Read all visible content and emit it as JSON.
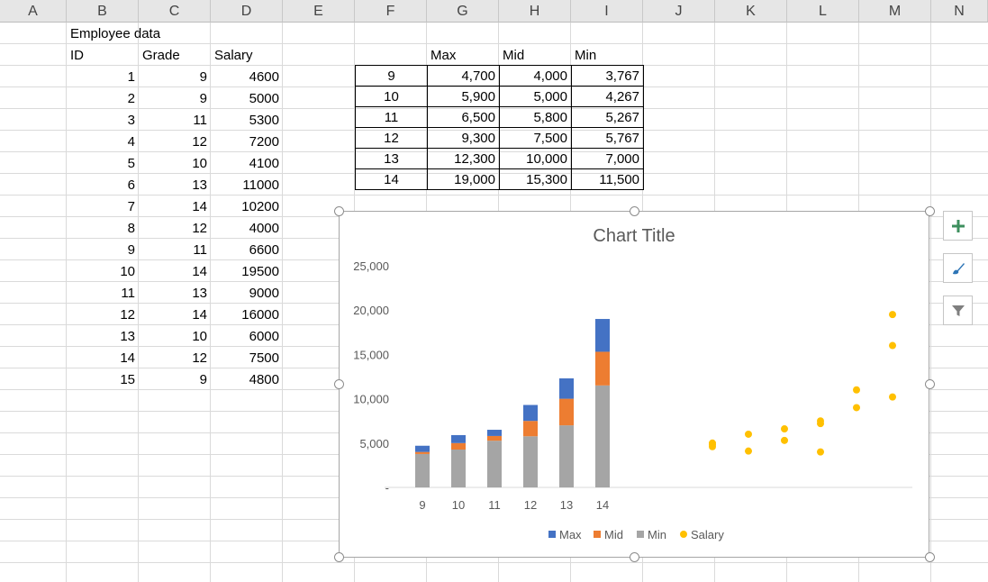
{
  "columns": [
    "A",
    "B",
    "C",
    "D",
    "E",
    "F",
    "G",
    "H",
    "I",
    "J",
    "K",
    "L",
    "M",
    "N"
  ],
  "sheet": {
    "title": "Employee data",
    "headers": {
      "id": "ID",
      "grade": "Grade",
      "salary": "Salary"
    },
    "rows": [
      {
        "id": "1",
        "grade": "9",
        "salary": "4600"
      },
      {
        "id": "2",
        "grade": "9",
        "salary": "5000"
      },
      {
        "id": "3",
        "grade": "11",
        "salary": "5300"
      },
      {
        "id": "4",
        "grade": "12",
        "salary": "7200"
      },
      {
        "id": "5",
        "grade": "10",
        "salary": "4100"
      },
      {
        "id": "6",
        "grade": "13",
        "salary": "11000"
      },
      {
        "id": "7",
        "grade": "14",
        "salary": "10200"
      },
      {
        "id": "8",
        "grade": "12",
        "salary": "4000"
      },
      {
        "id": "9",
        "grade": "11",
        "salary": "6600"
      },
      {
        "id": "10",
        "grade": "14",
        "salary": "19500"
      },
      {
        "id": "11",
        "grade": "13",
        "salary": "9000"
      },
      {
        "id": "12",
        "grade": "14",
        "salary": "16000"
      },
      {
        "id": "13",
        "grade": "10",
        "salary": "6000"
      },
      {
        "id": "14",
        "grade": "12",
        "salary": "7500"
      },
      {
        "id": "15",
        "grade": "9",
        "salary": "4800"
      }
    ]
  },
  "range_table": {
    "headers": {
      "max": "Max",
      "mid": "Mid",
      "min": "Min"
    },
    "rows": [
      {
        "grade": "9",
        "max": "4,700",
        "mid": "4,000",
        "min": "3,767"
      },
      {
        "grade": "10",
        "max": "5,900",
        "mid": "5,000",
        "min": "4,267"
      },
      {
        "grade": "11",
        "max": "6,500",
        "mid": "5,800",
        "min": "5,267"
      },
      {
        "grade": "12",
        "max": "9,300",
        "mid": "7,500",
        "min": "5,767"
      },
      {
        "grade": "13",
        "max": "12,300",
        "mid": "10,000",
        "min": "7,000"
      },
      {
        "grade": "14",
        "max": "19,000",
        "mid": "15,300",
        "min": "11,500"
      }
    ]
  },
  "chart_data": {
    "type": "bar",
    "title": "Chart Title",
    "categories": [
      "9",
      "10",
      "11",
      "12",
      "13",
      "14"
    ],
    "stacked": true,
    "series": [
      {
        "name": "Min",
        "values": [
          3767,
          4267,
          5267,
          5767,
          7000,
          11500
        ],
        "color": "#a5a5a5"
      },
      {
        "name": "Mid",
        "values": [
          4000,
          5000,
          5800,
          7500,
          10000,
          15300
        ],
        "color": "#ed7d31"
      },
      {
        "name": "Max",
        "values": [
          4700,
          5900,
          6500,
          9300,
          12300,
          19000
        ],
        "color": "#4472c4"
      }
    ],
    "scatter": {
      "name": "Salary",
      "color": "#ffc000",
      "points": [
        {
          "x": 9,
          "y": 4600
        },
        {
          "x": 9,
          "y": 5000
        },
        {
          "x": 9,
          "y": 4800
        },
        {
          "x": 10,
          "y": 4100
        },
        {
          "x": 10,
          "y": 6000
        },
        {
          "x": 11,
          "y": 5300
        },
        {
          "x": 11,
          "y": 6600
        },
        {
          "x": 12,
          "y": 7200
        },
        {
          "x": 12,
          "y": 4000
        },
        {
          "x": 12,
          "y": 7500
        },
        {
          "x": 13,
          "y": 11000
        },
        {
          "x": 13,
          "y": 9000
        },
        {
          "x": 14,
          "y": 10200
        },
        {
          "x": 14,
          "y": 19500
        },
        {
          "x": 14,
          "y": 16000
        }
      ]
    },
    "y_ticks": [
      "-",
      "5,000",
      "10,000",
      "15,000",
      "20,000",
      "25,000"
    ],
    "ylim": [
      0,
      25000
    ],
    "legend": [
      "Max",
      "Mid",
      "Min",
      "Salary"
    ],
    "legend_position": "bottom",
    "grid": false
  },
  "side_buttons": [
    {
      "name": "chart-elements-button",
      "icon": "plus-icon"
    },
    {
      "name": "chart-styles-button",
      "icon": "brush-icon"
    },
    {
      "name": "chart-filters-button",
      "icon": "funnel-icon"
    }
  ]
}
